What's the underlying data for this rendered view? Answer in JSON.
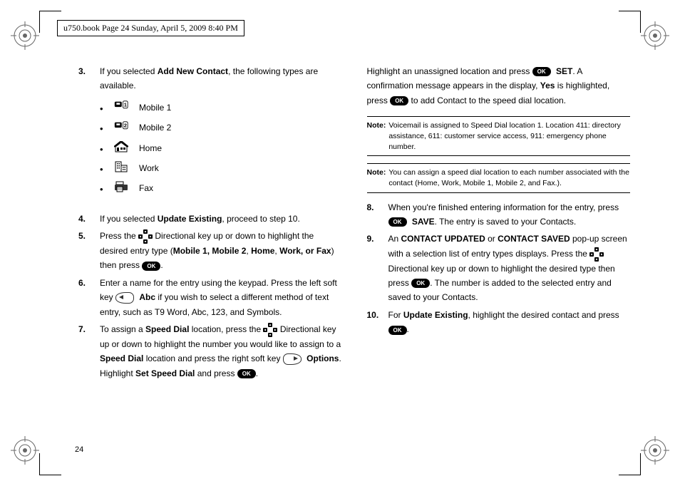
{
  "header": "u750.book  Page 24  Sunday, April 5, 2009  8:40 PM",
  "page_number": "24",
  "ok_label": "OK",
  "left_col": {
    "step3": {
      "num": "3.",
      "text_a": "If you selected ",
      "bold_a": "Add New Contact",
      "text_b": ", the following types are available.",
      "types": {
        "mobile1": "Mobile 1",
        "mobile2": "Mobile 2",
        "home": "Home",
        "work": "Work",
        "fax": "Fax"
      }
    },
    "step4": {
      "num": "4.",
      "text_a": "If you selected ",
      "bold_a": "Update Existing",
      "text_b": ", proceed to step 10."
    },
    "step5": {
      "num": "5.",
      "text_a": "Press the ",
      "text_b": " Directional key up or down to highlight the desired entry type (",
      "bold_b": "Mobile 1, Mobile 2",
      "text_c": ", ",
      "bold_c": "Home",
      "text_d": ", ",
      "bold_d": "Work, or Fax",
      "text_e": ") then press ",
      "text_f": "."
    },
    "step6": {
      "num": "6.",
      "text_a": "Enter a name for the entry using the keypad. Press the left soft key ",
      "bold_a": "Abc",
      "text_b": " if you wish to select a different method of text entry, such as T9 Word, Abc, 123, and Symbols."
    },
    "step7": {
      "num": "7.",
      "text_a": "To assign a ",
      "bold_a": "Speed Dial",
      "text_b": " location, press the ",
      "text_c": " Directional key up or down to highlight the number you would like to assign to a ",
      "bold_c": "Speed Dial",
      "text_d": " location and press the right soft key ",
      "bold_d": "Options",
      "text_e": ". Highlight ",
      "bold_e": "Set Speed Dial",
      "text_f": " and press ",
      "text_g": "."
    }
  },
  "right_col": {
    "cont7": {
      "text_a": "Highlight an unassigned location and press ",
      "bold_a": "SET",
      "text_b": ". A confirmation message appears in the display, ",
      "bold_b": "Yes",
      "text_c": " is highlighted, press ",
      "text_d": " to add Contact to the speed dial location."
    },
    "note1": {
      "label": "Note:",
      "text": "Voicemail is assigned to Speed Dial location 1. Location 411: directory assistance, 611: customer service access, 911: emergency phone number."
    },
    "note2": {
      "label": "Note:",
      "text": "You can assign a speed dial location to each number associated with the contact (Home, Work, Mobile 1, Mobile 2, and Fax.)."
    },
    "step8": {
      "num": "8.",
      "text_a": "When you're finished entering information for the entry, press ",
      "bold_a": "SAVE",
      "text_b": ". The entry is saved to your Contacts."
    },
    "step9": {
      "num": "9.",
      "text_a": "An ",
      "bold_a": "CONTACT UPDATED",
      "text_b": " or ",
      "bold_b": "CONTACT SAVED",
      "text_c": " pop-up screen with a selection list of entry types displays. Press the ",
      "text_d": " Directional key up or down to highlight the desired type then press ",
      "text_e": ". The number is added to the selected entry and saved to your Contacts."
    },
    "step10": {
      "num": "10.",
      "text_a": "For ",
      "bold_a": "Update Existing",
      "text_b": ", highlight the desired contact and press ",
      "text_c": "."
    }
  }
}
